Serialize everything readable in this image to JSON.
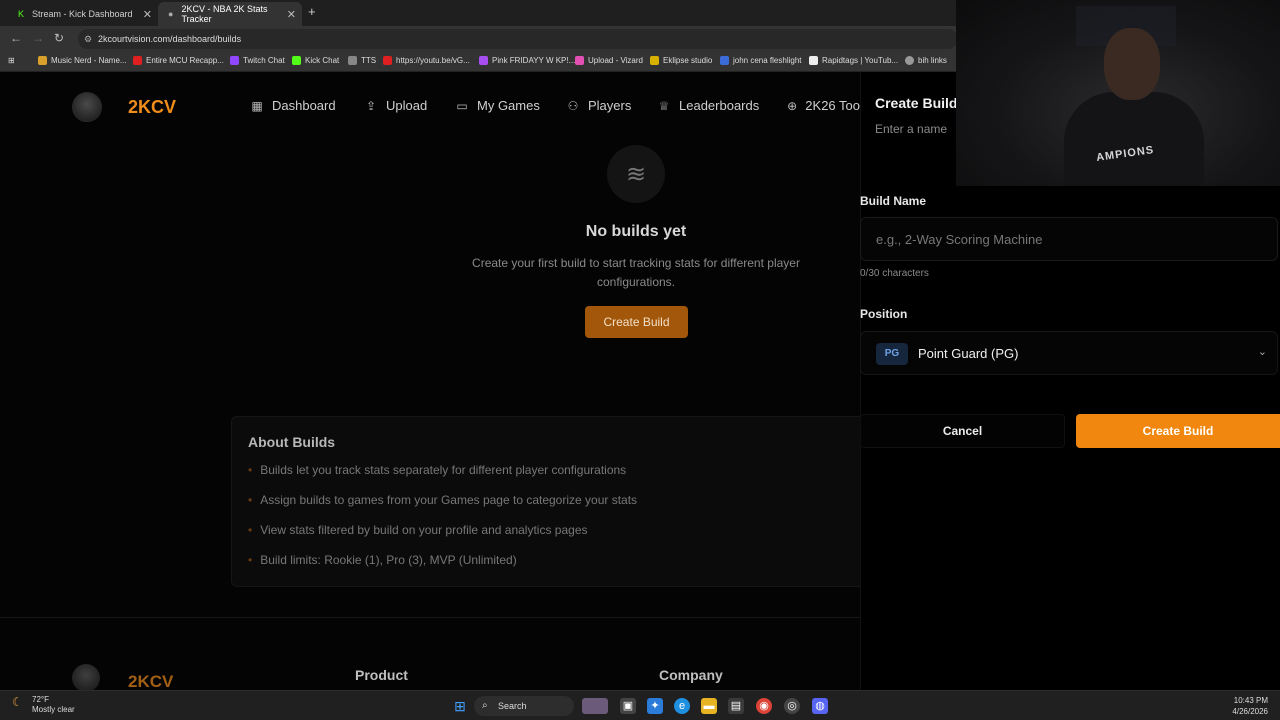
{
  "browser": {
    "tabs": [
      {
        "title": "Stream - Kick Dashboard",
        "icon": "kick-icon",
        "color": "#53fc18"
      },
      {
        "title": "2KCV - NBA 2K Stats Tracker",
        "icon": "2kcv-icon",
        "color": "#888888"
      }
    ],
    "url": "2kcourtvision.com/dashboard/builds",
    "bookmarks": [
      "Music Nerd - Name...",
      "Entire MCU Recapp...",
      "Twitch Chat",
      "Kick Chat",
      "TTS",
      "https://youtu.be/vG...",
      "Pink FRIDAYY W KP!...",
      "Upload - Vizard",
      "Eklipse studio",
      "john cena fleshlight",
      "Rapidtags | YouTub...",
      "bih links"
    ]
  },
  "site": {
    "logo_text": "2KCV",
    "nav": [
      {
        "label": "Dashboard",
        "icon": "dashboard-icon"
      },
      {
        "label": "Upload",
        "icon": "upload-icon"
      },
      {
        "label": "My Games",
        "icon": "gamepad-icon"
      },
      {
        "label": "Players",
        "icon": "players-icon"
      },
      {
        "label": "Leaderboards",
        "icon": "trophy-icon"
      },
      {
        "label": "2K26 Too",
        "icon": "globe-icon"
      }
    ]
  },
  "empty_state": {
    "title": "No builds yet",
    "description": "Create your first build to start tracking stats for different player configurations.",
    "button": "Create Build"
  },
  "about": {
    "title": "About Builds",
    "items": [
      "Builds let you track stats separately for different player configurations",
      "Assign builds to games from your Games page to categorize your stats",
      "View stats filtered by build on your profile and analytics pages",
      "Build limits: Rookie (1), Pro (3), MVP (Unlimited)"
    ]
  },
  "footer": {
    "logo_text": "2KCV",
    "columns": [
      "Product",
      "Company"
    ]
  },
  "panel": {
    "title": "Create Build",
    "subtitle": "Enter a name",
    "name_label": "Build Name",
    "name_placeholder": "e.g., 2-Way Scoring Machine",
    "char_count": "0/30 characters",
    "position_label": "Position",
    "position_badge": "PG",
    "position_value": "Point Guard (PG)",
    "cancel": "Cancel",
    "submit": "Create Build"
  },
  "webcam": {
    "shirt_text": "AMPIONS"
  },
  "taskbar": {
    "temp": "72°F",
    "weather": "Mostly clear",
    "search": "Search",
    "time": "10:43 PM",
    "date": "4/26/2026"
  }
}
